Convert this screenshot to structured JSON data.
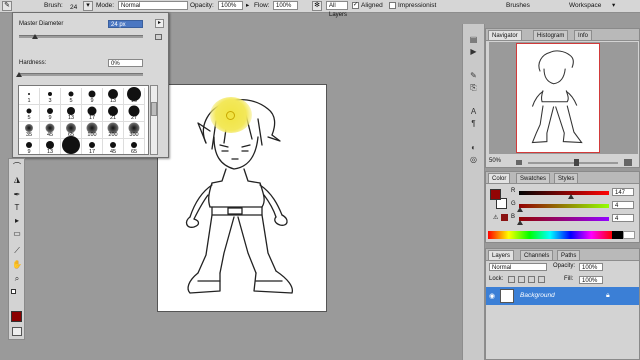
{
  "options_bar": {
    "brush_label": "Brush:",
    "brush_size": "24",
    "mode_label": "Mode:",
    "mode_value": "Normal",
    "opacity_label": "Opacity:",
    "opacity_value": "100%",
    "flow_label": "Flow:",
    "flow_value": "100%",
    "sample_value": "All Layers",
    "aligned_label": "Aligned",
    "impressionist_label": "Impressionist",
    "brushes_label": "Brushes",
    "workspace_label": "Workspace"
  },
  "brush_picker": {
    "master_diameter_label": "Master Diameter",
    "master_diameter_value": "24 px",
    "master_diameter_fraction": 0.13,
    "hardness_label": "Hardness:",
    "hardness_value": "0%",
    "hardness_fraction": 0.0,
    "presets": [
      {
        "size": "1",
        "dot": 1
      },
      {
        "size": "3",
        "dot": 2
      },
      {
        "size": "5",
        "dot": 2.5
      },
      {
        "size": "9",
        "dot": 3.5
      },
      {
        "size": "13",
        "dot": 5
      },
      {
        "size": "19",
        "dot": 7
      },
      {
        "size": "5",
        "dot": 2.5
      },
      {
        "size": "9",
        "dot": 3
      },
      {
        "size": "13",
        "dot": 4
      },
      {
        "size": "17",
        "dot": 4.5
      },
      {
        "size": "21",
        "dot": 5
      },
      {
        "size": "27",
        "dot": 5.5
      },
      {
        "size": "35",
        "dot": 4
      },
      {
        "size": "45",
        "dot": 4.5
      },
      {
        "size": "65",
        "dot": 5
      },
      {
        "size": "100",
        "dot": 5.5
      },
      {
        "size": "200",
        "dot": 5.5
      },
      {
        "size": "300",
        "dot": 5.5
      },
      {
        "size": "9",
        "dot": 3
      },
      {
        "size": "13",
        "dot": 4
      },
      {
        "size": "19",
        "dot": 9
      },
      {
        "size": "17",
        "dot": 3
      },
      {
        "size": "45",
        "dot": 3
      },
      {
        "size": "65",
        "dot": 3
      }
    ]
  },
  "navigator": {
    "tabs": [
      "Navigator",
      "Histogram",
      "Info"
    ],
    "zoom": "50%"
  },
  "color_panel": {
    "tabs": [
      "Color",
      "Swatches",
      "Styles"
    ],
    "r_label": "R",
    "g_label": "G",
    "b_label": "B",
    "r_value": "147",
    "g_value": "4",
    "b_value": "4",
    "r_fraction": 0.576,
    "g_fraction": 0.016,
    "b_fraction": 0.016,
    "foreground": "#930404",
    "background": "#ffffff"
  },
  "layers_panel": {
    "tabs": [
      "Layers",
      "Channels",
      "Paths"
    ],
    "blend_mode": "Normal",
    "opacity_label": "Opacity:",
    "opacity_value": "100%",
    "lock_label": "Lock:",
    "fill_label": "Fill:",
    "fill_value": "100%",
    "layer_name": "Background"
  },
  "toolbox": {
    "icons": [
      "lasso-icon",
      "bucket-icon",
      "pen-icon",
      "type-icon",
      "path-select-icon",
      "rectangle-icon",
      "eyedropper-icon",
      "hand-icon",
      "zoom-icon"
    ],
    "foreground_color": "#8b0000"
  },
  "brush_cursor_color": "#f2e84a"
}
